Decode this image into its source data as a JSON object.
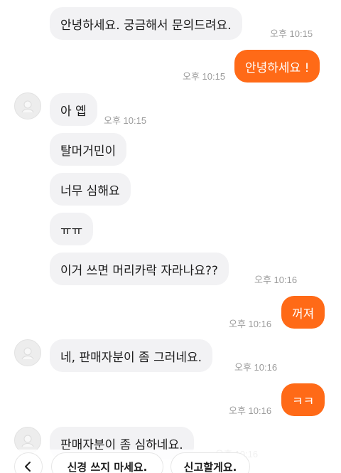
{
  "messages": [
    {
      "text": "안녕하세요. 궁금해서 문의드려요.",
      "time": "오후 10:15"
    },
    {
      "text": "안녕하세요 !",
      "time": "오후 10:15"
    },
    {
      "text": "아 옙",
      "time": "오후 10:15"
    },
    {
      "text": "탈머거민이"
    },
    {
      "text": "너무 심해요"
    },
    {
      "text": "ㅠㅠ"
    },
    {
      "text": "이거 쓰면 머리카락 자라나요??",
      "time": "오후 10:16"
    },
    {
      "text": "꺼져",
      "time": "오후 10:16"
    },
    {
      "text": "네, 판매자분이 좀 그러네요.",
      "time": "오후 10:16"
    },
    {
      "text": "ㅋㅋ",
      "time": "오후 10:16"
    },
    {
      "text": "판매자분이 좀 심하네요.",
      "time": "오후 10:16"
    }
  ],
  "quick_replies": {
    "back_icon": "chevron-left-icon",
    "options": [
      "신경 쓰지 마세요.",
      "신고할게요."
    ]
  },
  "colors": {
    "outgoing_bubble": "#ff6a17",
    "incoming_bubble": "#f2f2f4",
    "timestamp": "#9b9b9b"
  }
}
